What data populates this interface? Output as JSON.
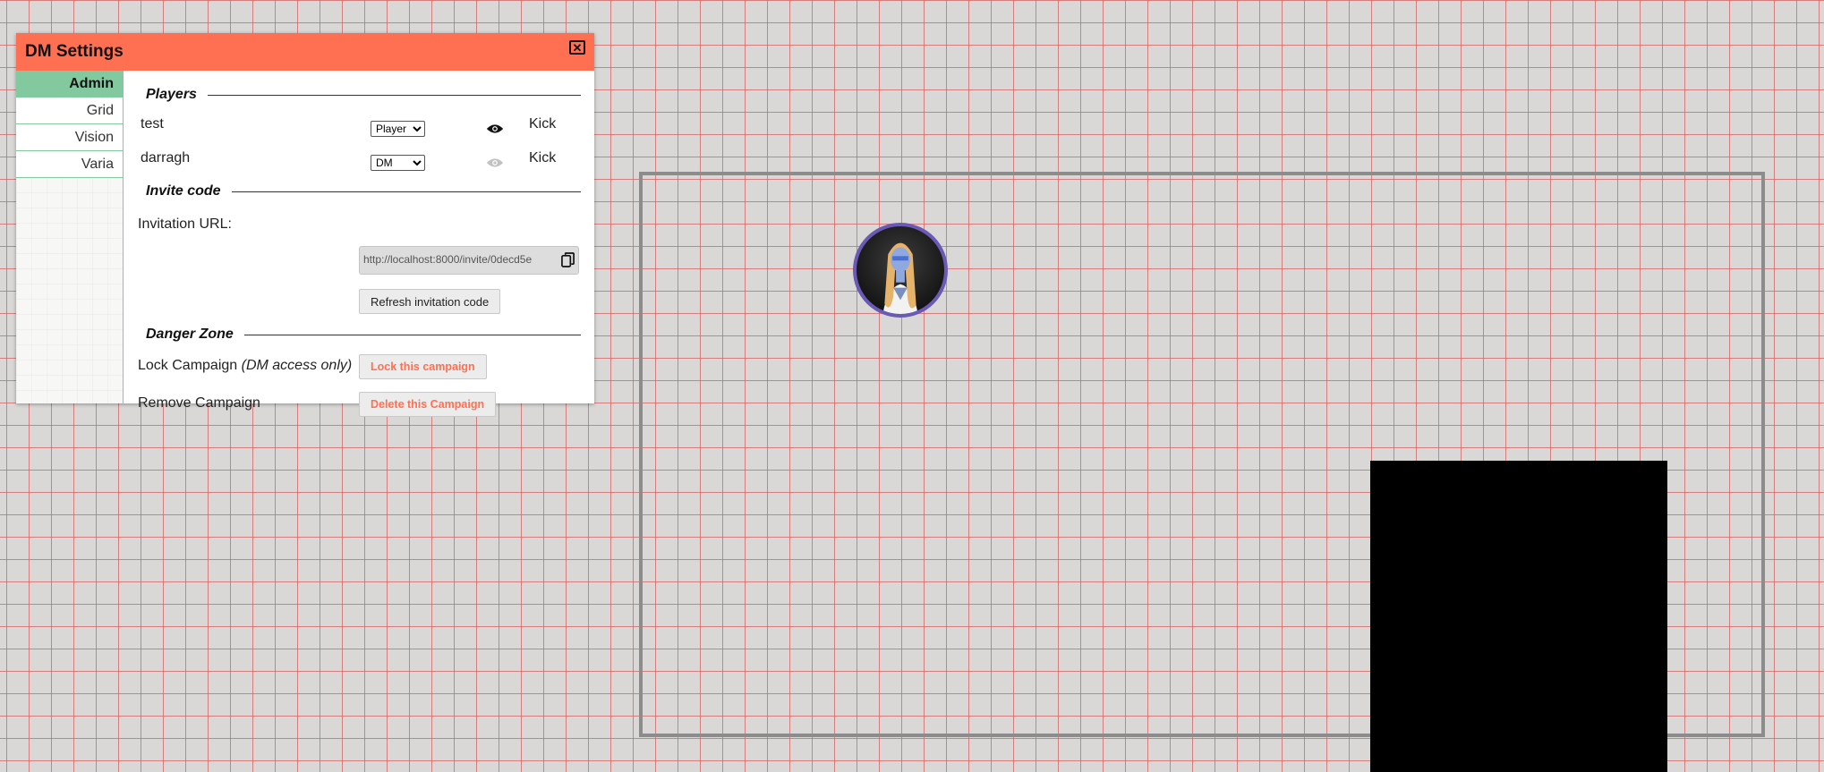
{
  "dialog": {
    "title": "DM Settings",
    "close_icon": "close-icon"
  },
  "sidebar": {
    "items": [
      {
        "label": "Admin",
        "active": true
      },
      {
        "label": "Grid",
        "active": false
      },
      {
        "label": "Vision",
        "active": false
      },
      {
        "label": "Varia",
        "active": false
      }
    ]
  },
  "players": {
    "heading": "Players",
    "list": [
      {
        "name": "test",
        "role": "Player",
        "visible": true,
        "eye_icon": "eye-icon",
        "kick_label": "Kick"
      },
      {
        "name": "darragh",
        "role": "DM",
        "visible": false,
        "eye_icon": "eye-icon",
        "kick_label": "Kick"
      }
    ]
  },
  "invite": {
    "heading": "Invite code",
    "url_label": "Invitation URL:",
    "url_value": "http://localhost:8000/invite/0decd5e",
    "copy_icon": "copy-icon",
    "refresh_label": "Refresh invitation code"
  },
  "danger": {
    "heading": "Danger Zone",
    "lock_label": "Lock Campaign",
    "lock_note": "(DM access only)",
    "lock_button": "Lock this campaign",
    "remove_label": "Remove Campaign",
    "remove_button": "Delete this Campaign",
    "button_color": "#ff7052"
  },
  "colors": {
    "header": "#ff7052",
    "sidebar_active": "#82c9a0",
    "grid_line": "#d66060",
    "token_border": "#6a59b5"
  }
}
